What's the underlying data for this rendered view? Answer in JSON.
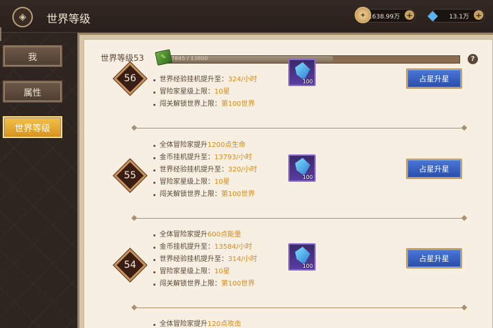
{
  "header": {
    "title": "世界等级",
    "gold": "1638.99万",
    "gems": "13.1万"
  },
  "sidebar": {
    "items": [
      {
        "label": "我",
        "active": false
      },
      {
        "label": "属性",
        "active": false
      },
      {
        "label": "世界等级",
        "active": true
      }
    ]
  },
  "level": {
    "label": "世界等级53",
    "exp_text": "7845 / 13800",
    "progress_fraction": 0.57
  },
  "entries": [
    {
      "level": "56",
      "bullets": [
        {
          "text": "世界经验挂机提升至：",
          "value": "324/小时"
        },
        {
          "text": "冒险家星级上限：",
          "value": "10星"
        },
        {
          "text": "闯关解锁世界上限：",
          "value": "第100世界"
        }
      ],
      "reward_count": "100",
      "button": "占星升星"
    },
    {
      "level": "55",
      "bullets": [
        {
          "text": "全体冒险家提升",
          "value": "1200点生命"
        },
        {
          "text": "金币挂机提升至：",
          "value": "13793/小时"
        },
        {
          "text": "世界经验挂机提升至：",
          "value": "320/小时"
        },
        {
          "text": "冒险家星级上限：",
          "value": "10星"
        },
        {
          "text": "闯关解锁世界上限：",
          "value": "第100世界"
        }
      ],
      "reward_count": "100",
      "button": "占星升星"
    },
    {
      "level": "54",
      "bullets": [
        {
          "text": "全体冒险家提升",
          "value": "600点能量"
        },
        {
          "text": "金币挂机提升至：",
          "value": "13584/小时"
        },
        {
          "text": "世界经验挂机提升至：",
          "value": "314/小时"
        },
        {
          "text": "冒险家星级上限：",
          "value": "10星"
        },
        {
          "text": "闯关解锁世界上限：",
          "value": "第100世界"
        }
      ],
      "reward_count": "100",
      "button": "占星升星"
    },
    {
      "bullets": [
        {
          "text": "全体冒险家提升",
          "value": "120点攻击"
        }
      ]
    }
  ],
  "icons": {
    "back": "back-emblem-icon",
    "gold": "coin-icon",
    "gems": "crystal-icon",
    "help": "question-icon",
    "exp": "green-book-icon",
    "reward": "blue-crystal-item-icon"
  },
  "colors": {
    "highlight": "#d58a1e",
    "active_tab": "#e8aa30",
    "button": "#3a62c0"
  }
}
